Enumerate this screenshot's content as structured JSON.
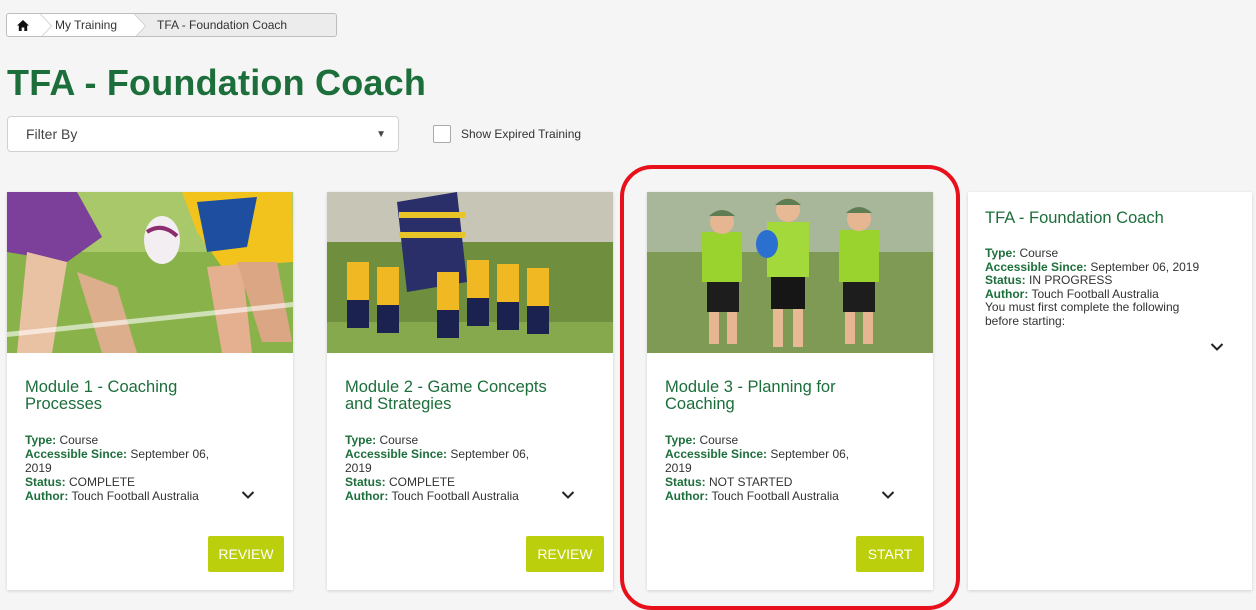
{
  "breadcrumb": {
    "items": [
      "My Training",
      "TFA - Foundation Coach"
    ]
  },
  "page_title": "TFA - Foundation Coach",
  "filter": {
    "placeholder": "Filter By"
  },
  "show_expired": {
    "label": "Show Expired Training",
    "checked": false
  },
  "labels": {
    "type": "Type:",
    "accessible_since": "Accessible Since:",
    "status": "Status:",
    "author": "Author:"
  },
  "modules": [
    {
      "title": "Module 1 - Coaching Processes",
      "type": "Course",
      "accessible_since": "September 06, 2019",
      "status": "COMPLETE",
      "author": "Touch Football Australia",
      "button": "REVIEW"
    },
    {
      "title": "Module 2 - Game Concepts and Strategies",
      "type": "Course",
      "accessible_since": "September 06, 2019",
      "status": "COMPLETE",
      "author": "Touch Football Australia",
      "button": "REVIEW"
    },
    {
      "title": "Module 3 - Planning for Coaching",
      "type": "Course",
      "accessible_since": "September 06, 2019",
      "status": "NOT STARTED",
      "author": "Touch Football Australia",
      "button": "START"
    }
  ],
  "summary": {
    "title": "TFA - Foundation Coach",
    "type": "Course",
    "accessible_since": "September 06, 2019",
    "status": "IN PROGRESS",
    "author": "Touch Football Australia",
    "prerequisite_note": "You must first complete the following before starting:"
  },
  "colors": {
    "brand_green": "#1c6e3b",
    "button": "#bccf0d",
    "highlight": "#e8111b"
  }
}
